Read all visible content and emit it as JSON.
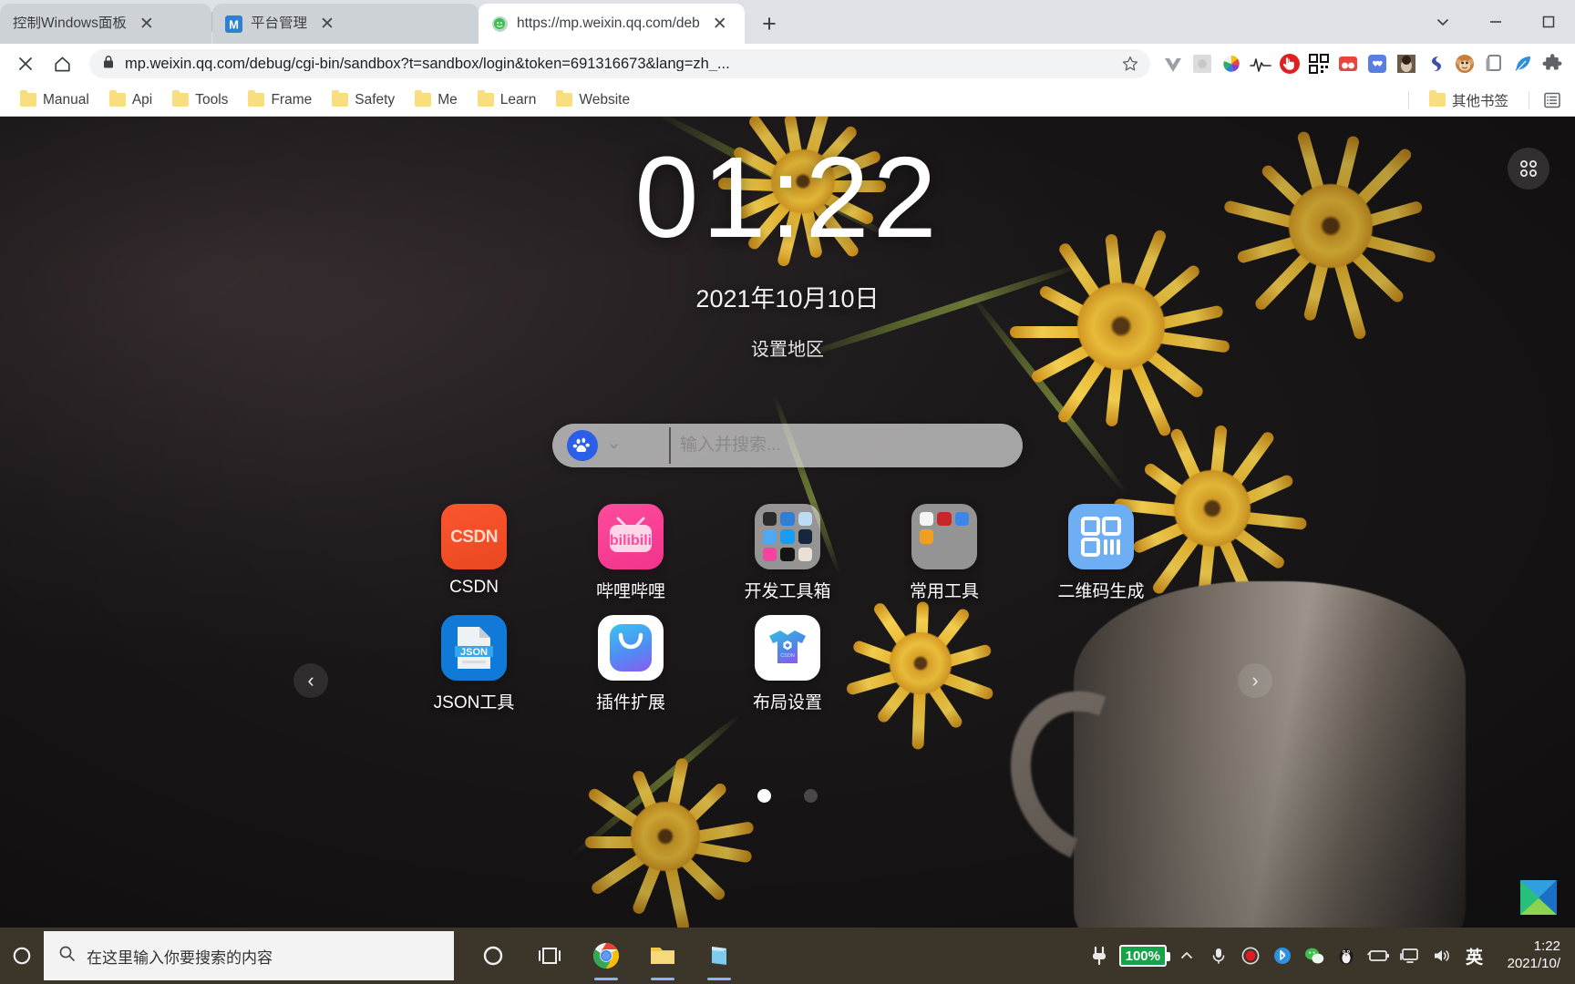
{
  "browser": {
    "tabs": [
      {
        "title": "控制Windows面板",
        "favicon": "none",
        "active": false
      },
      {
        "title": "平台管理",
        "favicon": "m-logo-icon",
        "active": false
      },
      {
        "title": "https://mp.weixin.qq.com/deb",
        "favicon": "wechat-icon",
        "active": true
      }
    ],
    "new_tab_label": "+",
    "close_label": "✕",
    "window_controls": {
      "minimize": "—",
      "maximize": "☐",
      "list": "⌄"
    },
    "omnibox": {
      "host": "mp.weixin.qq.com",
      "path": "/debug/cgi-bin/sandbox?t=sandbox/login&token=691316673&lang=zh_...",
      "full_url": "mp.weixin.qq.com/debug/cgi-bin/sandbox?t=sandbox/login&token=691316673&lang=zh_...",
      "lock_icon": "lock-icon",
      "star_icon": "bookmark-star-icon"
    },
    "nav": {
      "stop_label": "✕",
      "home_label": "⌂"
    },
    "extensions": [
      {
        "name": "vue-devtools-icon",
        "color": "#8e9196"
      },
      {
        "name": "grey-square-extension-icon",
        "color": "#d8d8d8"
      },
      {
        "name": "color-wheel-extension-icon",
        "color": "#3db54a"
      },
      {
        "name": "waveform-extension-icon",
        "color": "#2b2b2b"
      },
      {
        "name": "adblock-stop-extension-icon",
        "color": "#e63329"
      },
      {
        "name": "qrcode-extension-icon",
        "color": "#111111"
      },
      {
        "name": "red-panda-extension-icon",
        "color": "#e8453c"
      },
      {
        "name": "blue-heart-extension-icon",
        "color": "#5b7fe0"
      },
      {
        "name": "photo-extension-icon",
        "color": "#6b5b4a"
      },
      {
        "name": "swirl-extension-icon",
        "color": "#3f4faa"
      },
      {
        "name": "monkey-extension-icon",
        "color": "#c97d3c"
      },
      {
        "name": "pages-extension-icon",
        "color": "#9aa0a6"
      },
      {
        "name": "feather-extension-icon",
        "color": "#2f8fd6"
      },
      {
        "name": "puzzle-extensions-icon",
        "color": "#5f6368"
      }
    ],
    "bookmarks": [
      {
        "label": "Manual"
      },
      {
        "label": "Api"
      },
      {
        "label": "Tools"
      },
      {
        "label": "Frame"
      },
      {
        "label": "Safety"
      },
      {
        "label": "Me"
      },
      {
        "label": "Learn"
      },
      {
        "label": "Website"
      }
    ],
    "other_bookmarks": {
      "label": "其他书签"
    }
  },
  "newtab": {
    "apps_button": "grid-apps-icon",
    "clock": "01:22",
    "date": "2021年10月10日",
    "region_link": "设置地区",
    "search": {
      "engine": "baidu-paw-icon",
      "placeholder": "输入并搜索...",
      "value": ""
    },
    "shortcuts": [
      {
        "label": "CSDN",
        "icon": "csdn-icon",
        "glyph": "csdn"
      },
      {
        "label": "哔哩哔哩",
        "icon": "bilibili-icon",
        "glyph": "bilibili"
      },
      {
        "label": "开发工具箱",
        "icon": "folder-icon",
        "glyph": "folder9"
      },
      {
        "label": "常用工具",
        "icon": "folder-icon",
        "glyph": "folder4"
      },
      {
        "label": "二维码生成",
        "icon": "qrcode-icon",
        "glyph": "qr"
      },
      {
        "label": "JSON工具",
        "icon": "json-file-icon",
        "glyph": "json"
      },
      {
        "label": "插件扩展",
        "icon": "plugin-icon",
        "glyph": "plugin"
      },
      {
        "label": "布局设置",
        "icon": "layout-settings-icon",
        "glyph": "tshirt"
      }
    ],
    "pager": {
      "prev": "‹",
      "next": "›",
      "pages": 2,
      "current": 1
    }
  },
  "taskbar": {
    "start_icon": "windows-start-icon",
    "search_placeholder": "在这里输入你要搜索的内容",
    "cortana_icon": "cortana-circle-icon",
    "taskview_icon": "task-view-icon",
    "apps": [
      {
        "name": "chrome-taskbar-icon",
        "running": true
      },
      {
        "name": "file-explorer-taskbar-icon",
        "running": true
      },
      {
        "name": "store-taskbar-icon",
        "running": true
      }
    ],
    "tray": {
      "plug_icon": "power-plug-icon",
      "battery_percent": "100%",
      "chevron_icon": "show-hidden-icons-icon",
      "mic_icon": "microphone-icon",
      "record_icon": "record-icon",
      "bluetooth_icon": "bluetooth-icon",
      "wechat_icon": "wechat-tray-icon",
      "qq_icon": "qq-penguin-icon",
      "battery_icon": "battery-icon",
      "network_icon": "network-display-icon",
      "volume_icon": "volume-icon",
      "ime_label": "英"
    },
    "clock_time": "1:22",
    "clock_date": "2021/10/"
  }
}
